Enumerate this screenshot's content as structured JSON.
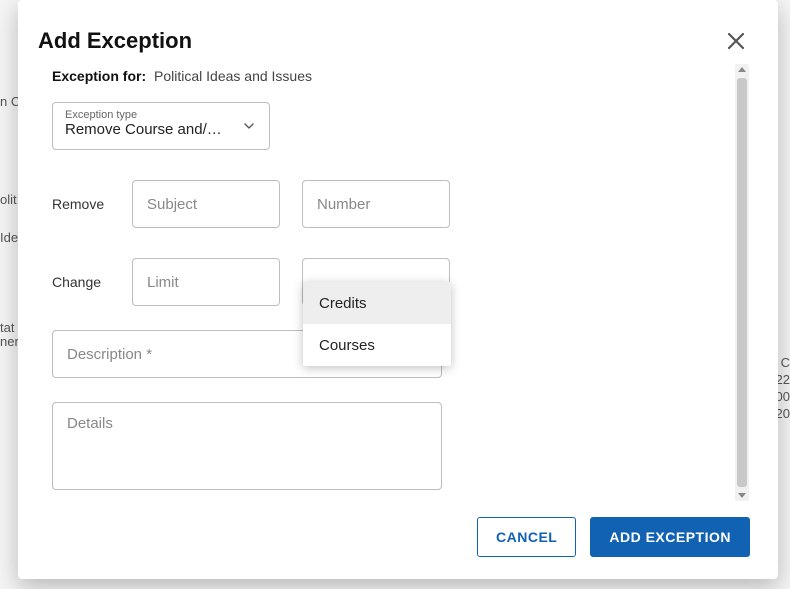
{
  "modal": {
    "title": "Add Exception",
    "exception_for_label": "Exception for:",
    "exception_for_value": "Political Ideas and Issues",
    "exception_type_label": "Exception type",
    "exception_type_value": "Remove Course and/…",
    "remove_label": "Remove",
    "subject_placeholder": "Subject",
    "number_placeholder": "Number",
    "change_label": "Change",
    "limit_placeholder": "Limit",
    "description_placeholder": "Description *",
    "details_placeholder": "Details",
    "dropdown": {
      "option1": "Credits",
      "option2": "Courses"
    },
    "buttons": {
      "cancel": "Cancel",
      "add": "Add Exception"
    }
  },
  "backdrop": {
    "t1": "n C",
    "t2": "olit",
    "t3": "Ide",
    "t4": "tat",
    "t5": "ner",
    "r1": "C",
    "r2": "22",
    "r3": "00",
    "r4": "20"
  }
}
